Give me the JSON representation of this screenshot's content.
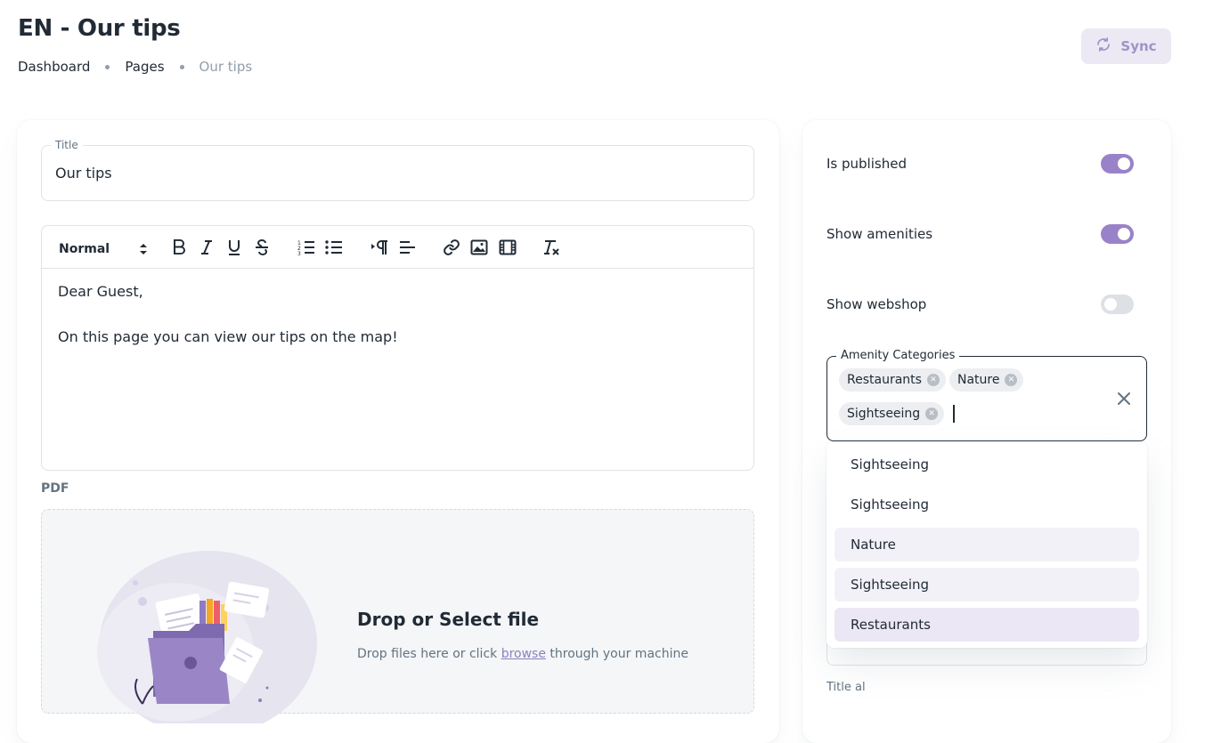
{
  "header": {
    "title": "EN - Our tips",
    "breadcrumb": [
      "Dashboard",
      "Pages",
      "Our tips"
    ],
    "sync_label": "Sync"
  },
  "content": {
    "title_label": "Title",
    "title_value": "Our tips",
    "editor": {
      "format": "Normal",
      "toolbar_icons": [
        "bold-icon",
        "italic-icon",
        "underline-icon",
        "strikethrough-icon",
        "ordered-list-icon",
        "bullet-list-icon",
        "text-direction-icon",
        "align-icon",
        "link-icon",
        "image-icon",
        "video-icon",
        "clear-format-icon"
      ],
      "paragraphs": [
        "Dear Guest,",
        "On this page you can view our tips on the map!"
      ]
    },
    "pdf_label": "PDF",
    "upload": {
      "title": "Drop or Select file",
      "desc_before": "Drop files here or click ",
      "desc_link": "browse",
      "desc_after": " through your machine"
    }
  },
  "settings": {
    "switches": [
      {
        "label": "Is published",
        "checked": true
      },
      {
        "label": "Show amenities",
        "checked": true
      },
      {
        "label": "Show webshop",
        "checked": false
      }
    ],
    "amenity": {
      "label": "Amenity Categories",
      "chips": [
        "Restaurants",
        "Nature",
        "Sightseeing"
      ]
    },
    "options": [
      "Sightseeing",
      "Sightseeing",
      "Nature",
      "Sightseeing",
      "Restaurants"
    ],
    "partial_label": "Title al"
  },
  "colors": {
    "accent": "#9a82c8",
    "sync_bg": "#ece8f4",
    "sync_text": "#a093c6",
    "text": "#212b36",
    "muted": "#919eab"
  }
}
